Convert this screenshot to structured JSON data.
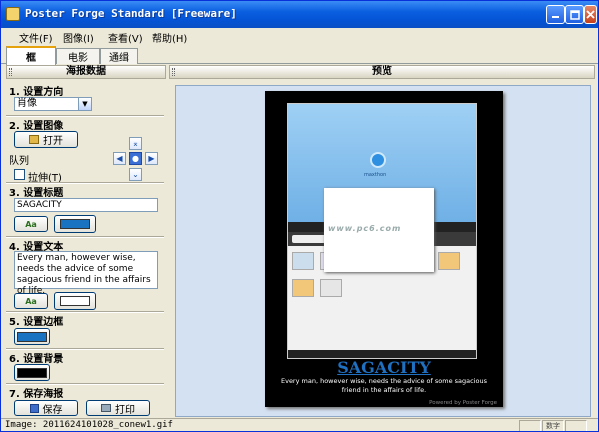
{
  "window": {
    "title": "Poster Forge Standard [Freeware]"
  },
  "menu": {
    "file": "文件(F)",
    "image": "图像(I)",
    "view": "查看(V)",
    "help": "帮助(H)"
  },
  "tabs": [
    {
      "label": "框"
    },
    {
      "label": "电影"
    },
    {
      "label": "通缉"
    }
  ],
  "left_panel": {
    "header": "海报数据",
    "orientation": {
      "heading": "1. 设置方向",
      "value": "肖像"
    },
    "image": {
      "heading": "2. 设置图像",
      "open_label": "打开",
      "queue_label": "队列",
      "stretch_label": "拉伸(T)"
    },
    "title": {
      "heading": "3. 设置标题",
      "value": "SAGACITY",
      "font_button": "Aa",
      "color": "#1a73c0"
    },
    "text": {
      "heading": "4. 设置文本",
      "value": "Every man, however wise, needs the advice of some sagacious friend in the affairs of life.",
      "font_button": "Aa",
      "color": "#ffffff"
    },
    "border": {
      "heading": "5. 设置边框",
      "color": "#1a73c0"
    },
    "background": {
      "heading": "6. 设置背景",
      "color": "#000000"
    },
    "save": {
      "heading": "7. 保存海报",
      "save_label": "保存",
      "print_label": "打印"
    }
  },
  "preview": {
    "header": "预览",
    "poster_title": "SAGACITY",
    "poster_text": "Every man, however wise, needs the advice of some sagacious friend in the affairs of life.",
    "powered": "Powered by Poster Forge",
    "watermark": "www.pc6.com",
    "image_caption": "maxthon"
  },
  "status": {
    "text": "Image: 2011624101028_conew1.gif",
    "num": "数字"
  }
}
